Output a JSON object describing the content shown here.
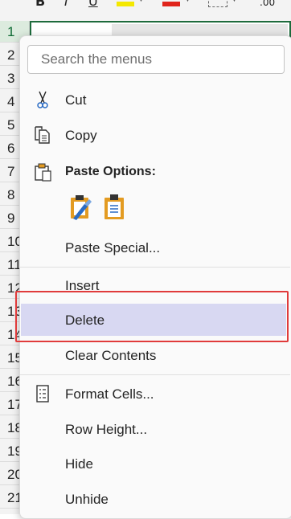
{
  "toolbar": {
    "bold": "B",
    "italic": "I",
    "underline": "U",
    "decimal": ".00",
    "fill_color": "#f4e800",
    "font_color": "#e0241b"
  },
  "row_headers": [
    "1",
    "2",
    "3",
    "4",
    "5",
    "6",
    "7",
    "8",
    "9",
    "10",
    "11",
    "12",
    "13",
    "14",
    "15",
    "16",
    "17",
    "18",
    "19",
    "20",
    "21"
  ],
  "menu": {
    "search_placeholder": "Search the menus",
    "items": {
      "cut": "Cut",
      "copy": "Copy",
      "paste_options": "Paste Options:",
      "paste_special": "Paste Special...",
      "insert": "Insert",
      "delete": "Delete",
      "clear_contents": "Clear Contents",
      "format_cells": "Format Cells...",
      "row_height": "Row Height...",
      "hide": "Hide",
      "unhide": "Unhide"
    },
    "paste_icons": [
      "paste-formatting-icon",
      "paste-icon"
    ],
    "highlight_item": "delete",
    "highlight_color": "#d8d8f2",
    "annotation_color": "#e03b3b"
  },
  "colors": {
    "accent_green": "#1e6b3c",
    "icon_blue": "#2b6cc4",
    "icon_orange": "#e39b22"
  }
}
